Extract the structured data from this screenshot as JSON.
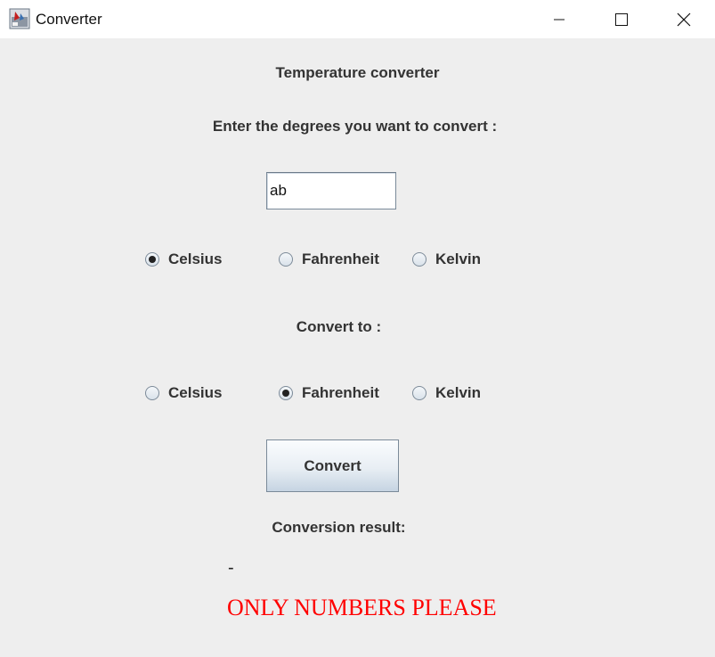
{
  "window": {
    "title": "Converter"
  },
  "header": {
    "title": "Temperature converter",
    "prompt": "Enter the degrees you want to convert :"
  },
  "input": {
    "value": "ab"
  },
  "from_units": [
    {
      "label": "Celsius",
      "selected": true
    },
    {
      "label": "Fahrenheit",
      "selected": false
    },
    {
      "label": "Kelvin",
      "selected": false
    }
  ],
  "convert_to_label": "Convert to :",
  "to_units": [
    {
      "label": "Celsius",
      "selected": false
    },
    {
      "label": "Fahrenheit",
      "selected": true
    },
    {
      "label": "Kelvin",
      "selected": false
    }
  ],
  "convert_button": "Convert",
  "result": {
    "label": "Conversion result:",
    "value": "-",
    "error": "ONLY NUMBERS PLEASE"
  },
  "colors": {
    "background": "#eeeeee",
    "error": "#ff0000"
  }
}
